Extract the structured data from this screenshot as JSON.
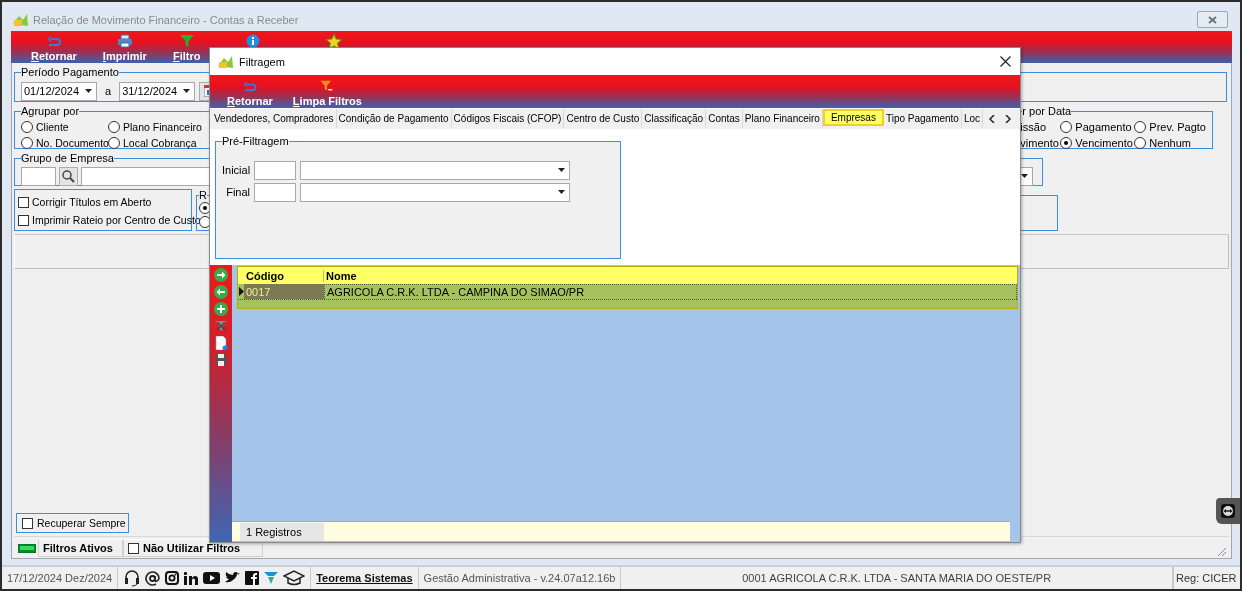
{
  "main_window": {
    "title": "Relação de Movimento Financeiro - Contas a Receber",
    "toolbar": [
      {
        "label": "Retornar"
      },
      {
        "label": "Imprimir"
      },
      {
        "label": "Filtro"
      },
      {
        "kind": "info"
      },
      {
        "kind": "star"
      }
    ],
    "periodo": {
      "title": "Período Pagamento",
      "start": "01/12/2024",
      "separator": "a",
      "end": "31/12/2024"
    },
    "agrupar": {
      "title": "Agrupar por",
      "options": [
        {
          "label": "Cliente",
          "selected": false
        },
        {
          "label": "Plano Financeiro",
          "selected": false
        },
        {
          "label": "No. Documento",
          "selected": false
        },
        {
          "label": "Local Cobrança",
          "selected": false
        }
      ]
    },
    "por_data": {
      "title": "r por Data",
      "options": [
        {
          "label": "issão",
          "kind": "partial"
        },
        {
          "label": "Pagamento",
          "kind": "radio",
          "selected": false
        },
        {
          "label": "Prev. Pagto",
          "kind": "radio",
          "selected": false
        },
        {
          "label": "vimento",
          "kind": "partial"
        },
        {
          "label": "Vencimento",
          "kind": "radio",
          "selected": true
        },
        {
          "label": "Nenhum",
          "kind": "radio",
          "selected": false
        }
      ]
    },
    "grupo_empresa": {
      "title": "Grupo de Empresa"
    },
    "checks": [
      {
        "label": "Corrigir Títulos em Aberto",
        "checked": false
      },
      {
        "label": "Imprimir Rateio por Centro de Custo",
        "checked": false
      }
    ],
    "r_group": {
      "title": "R",
      "options": [
        {
          "selected": true
        },
        {
          "selected": false
        }
      ]
    },
    "recuperar": {
      "label": "Recuperar Sempre",
      "checked": false
    },
    "filtros_ativos": "Filtros Ativos",
    "nao_utilizar": {
      "label": "Não Utilizar Filtros",
      "checked": false
    }
  },
  "dialog": {
    "title": "Filtragem",
    "toolbar": [
      {
        "label": "Retornar",
        "kind": "return"
      },
      {
        "label": "Limpa Filtros",
        "kind": "clear"
      }
    ],
    "tabs": [
      {
        "label": "Vendedores, Compradores",
        "selected": false
      },
      {
        "label": "Condição de Pagamento",
        "selected": false
      },
      {
        "label": "Códigos Fiscais (CFOP)",
        "selected": false
      },
      {
        "label": "Centro de Custo",
        "selected": false
      },
      {
        "label": "Classificação",
        "selected": false
      },
      {
        "label": "Contas",
        "selected": false
      },
      {
        "label": "Plano Financeiro",
        "selected": false
      },
      {
        "label": "Empresas",
        "selected": true
      },
      {
        "label": "Tipo Pagamento",
        "selected": false
      },
      {
        "label": "Loc",
        "selected": false
      }
    ],
    "prefilter": {
      "title": "Pré-Filtragem",
      "rows": [
        {
          "label": "Inicial"
        },
        {
          "label": "Final"
        }
      ]
    },
    "table": {
      "columns": [
        "Código",
        "Nome"
      ],
      "rows": [
        {
          "selected": true,
          "cells": [
            {
              "text": "0017",
              "focused": true
            },
            {
              "text": "AGRICOLA C.R.K. LTDA - CAMPINA DO SIMAO/PR",
              "focused": false
            }
          ]
        }
      ]
    },
    "footer": "1 Registros"
  },
  "status_bar": {
    "date": "17/12/2024 Dez/2024",
    "link": "Teorema Sistemas",
    "app": "Gestão Administrativa - v.24.07a12.16b",
    "company": "0001 AGRICOLA C.R.K. LTDA - SANTA MARIA DO OESTE/PR",
    "user": "Reg: CICER"
  }
}
